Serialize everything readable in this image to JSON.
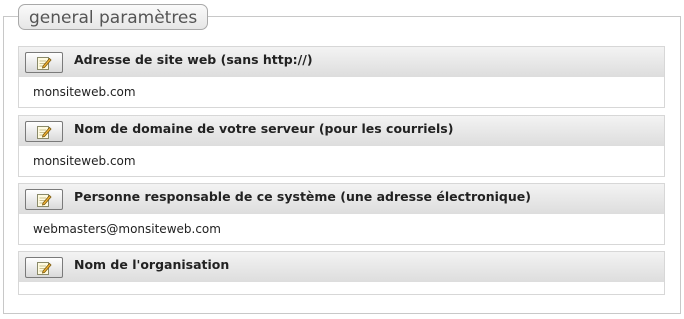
{
  "section": {
    "legend": "general paramètres"
  },
  "settings": [
    {
      "title": "Adresse de site web (sans http://)",
      "value": "monsiteweb.com",
      "edit_icon": "edit-pencil-icon"
    },
    {
      "title": "Nom de domaine de votre serveur (pour les courriels)",
      "value": "monsiteweb.com",
      "edit_icon": "edit-pencil-icon"
    },
    {
      "title": "Personne responsable de ce système (une adresse électronique)",
      "value": "webmasters@monsiteweb.com",
      "edit_icon": "edit-pencil-icon"
    },
    {
      "title": "Nom de l'organisation",
      "value": "",
      "edit_icon": "edit-pencil-icon"
    }
  ]
}
